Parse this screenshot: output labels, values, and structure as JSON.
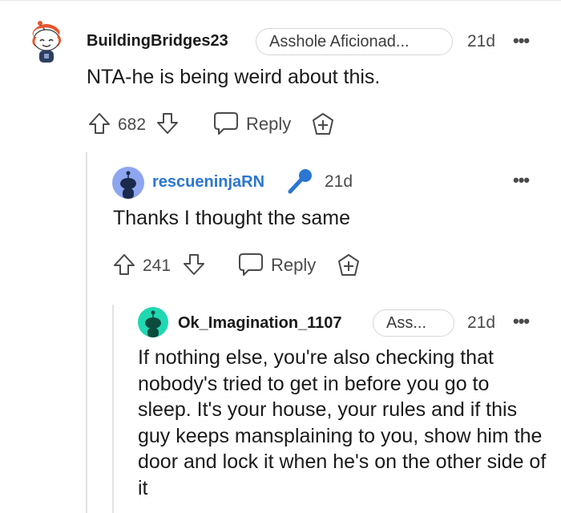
{
  "comments": [
    {
      "username": "BuildingBridges23",
      "flair": "Asshole Aficionad...",
      "age": "21d",
      "body": "NTA-he is being weird about this.",
      "votes": "682",
      "reply_label": "Reply",
      "avatar_color": "#e8552c"
    },
    {
      "username": "rescueninjaRN",
      "age": "21d",
      "body": "Thanks I thought the same",
      "votes": "241",
      "reply_label": "Reply",
      "username_color": "#2a76d2",
      "avatar_color": "#8ea5f0",
      "badge_icon": "microphone-icon"
    },
    {
      "username": "Ok_Imagination_1107",
      "flair": "Ass...",
      "age": "21d",
      "body": "If nothing else, you're also checking that nobody's tried to get in before you go to sleep. It's your house, your rules and if this guy keeps mansplaining to you, show him the door and lock it when he's on the other side of it",
      "avatar_color": "#1fd8b2"
    }
  ],
  "more_options": "•••"
}
